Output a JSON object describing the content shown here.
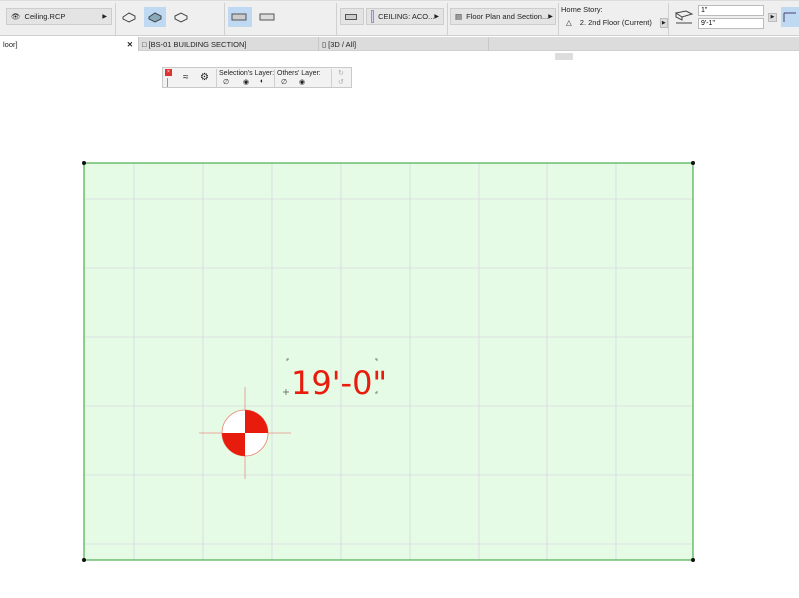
{
  "toolbar": {
    "view_set": "Ceiling.RCP",
    "layer_display": "CEILING: ACO...",
    "floor_plan_display": "Floor Plan and Section...",
    "home_story_label": "Home Story:",
    "home_story_value": "2. 2nd Floor (Current)",
    "thickness": "1\"",
    "height": "9'-1\""
  },
  "tabs": [
    {
      "label": "loor]",
      "active": true
    },
    {
      "label": "[BS-01 BUILDING SECTION]"
    },
    {
      "label": "[3D / All]"
    }
  ],
  "palette": {
    "selection_layer": "Selection's Layer:",
    "others_layer": "Others' Layer:"
  },
  "drawing": {
    "dimension": "19'-0\"",
    "fill_color": "#e5fbe5",
    "border_color": "#4cae4c",
    "accent_color": "#e81c0c"
  }
}
